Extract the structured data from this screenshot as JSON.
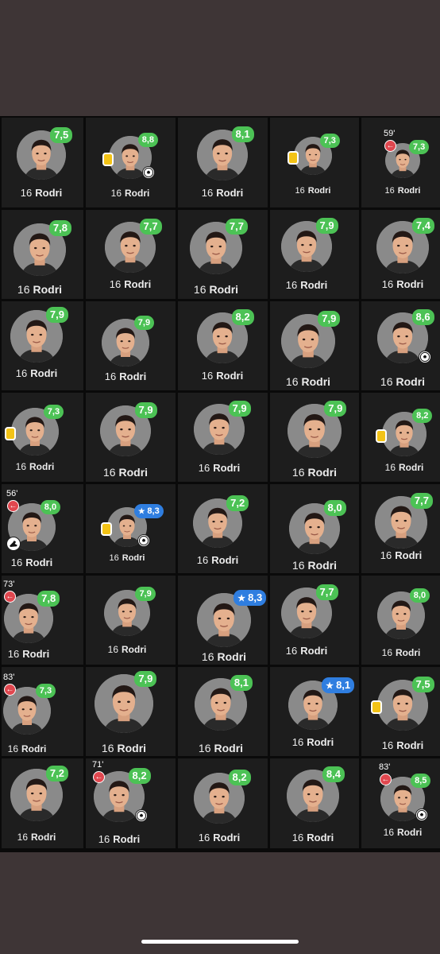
{
  "player": {
    "number": "16",
    "name": "Rodri"
  },
  "colors": {
    "rating_green": "#4cc255",
    "rating_blue": "#2f7ee0",
    "sub_red": "#e0474f",
    "yellow_card": "#f3c316"
  },
  "cards": [
    {
      "rating": "7,5"
    },
    {
      "rating": "8,8",
      "yellow": true,
      "goal": true
    },
    {
      "rating": "8,1"
    },
    {
      "rating": "7,3",
      "yellow": true
    },
    {
      "rating": "7,3",
      "sub_minute": "59'"
    },
    {
      "rating": "7,8"
    },
    {
      "rating": "7,7"
    },
    {
      "rating": "7,7"
    },
    {
      "rating": "7,9"
    },
    {
      "rating": "7,4"
    },
    {
      "rating": "7,9"
    },
    {
      "rating": "7,9"
    },
    {
      "rating": "8,2"
    },
    {
      "rating": "7,9"
    },
    {
      "rating": "8,6",
      "goal": true
    },
    {
      "rating": "7,3",
      "yellow": true
    },
    {
      "rating": "7,9"
    },
    {
      "rating": "7,9"
    },
    {
      "rating": "7,9"
    },
    {
      "rating": "8,2",
      "yellow": true
    },
    {
      "rating": "8,0",
      "sub_minute": "56'",
      "assist": true
    },
    {
      "rating": "8,3",
      "motm": true,
      "yellow": true,
      "goal": true
    },
    {
      "rating": "7,2"
    },
    {
      "rating": "8,0"
    },
    {
      "rating": "7,7"
    },
    {
      "rating": "7,8",
      "sub_minute": "73'"
    },
    {
      "rating": "7,9"
    },
    {
      "rating": "8,3",
      "motm": true
    },
    {
      "rating": "7,7"
    },
    {
      "rating": "8,0"
    },
    {
      "rating": "7,3",
      "sub_minute": "83'"
    },
    {
      "rating": "7,9"
    },
    {
      "rating": "8,1"
    },
    {
      "rating": "8,1",
      "motm": true
    },
    {
      "rating": "7,5",
      "yellow": true
    },
    {
      "rating": "7,2"
    },
    {
      "rating": "8,2",
      "sub_minute": "71'",
      "goal": true
    },
    {
      "rating": "8,2"
    },
    {
      "rating": "8,4"
    },
    {
      "rating": "8,5",
      "sub_minute": "83'",
      "goal": true
    }
  ]
}
